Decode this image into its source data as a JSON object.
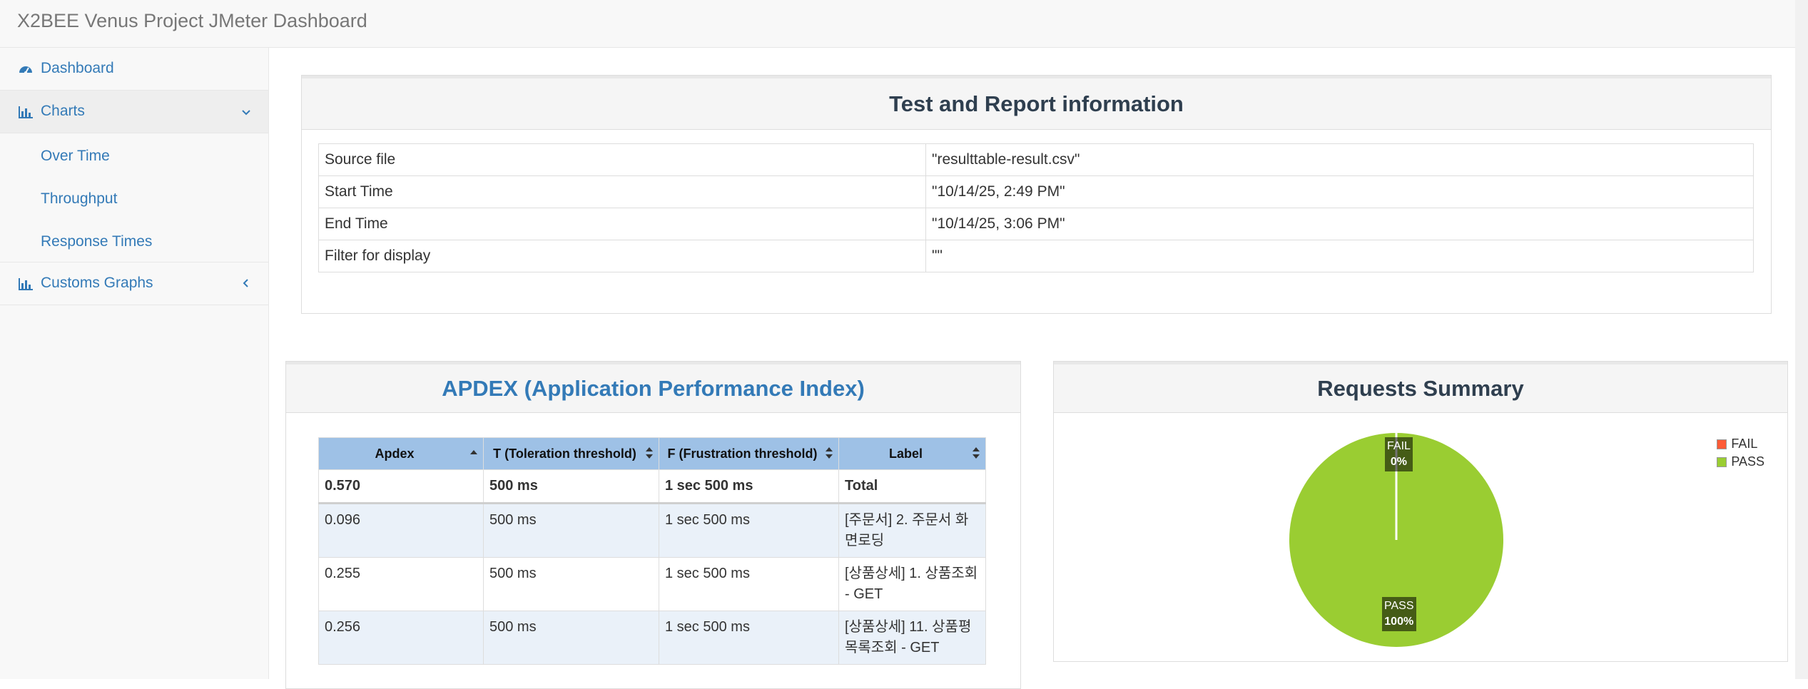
{
  "navbar": {
    "brand": "X2BEE Venus Project JMeter Dashboard"
  },
  "sidebar": {
    "items": [
      {
        "label": "Dashboard",
        "icon": "dashboard-icon"
      },
      {
        "label": "Charts",
        "icon": "bar-chart-icon",
        "expanded": true
      },
      {
        "label": "Customs Graphs",
        "icon": "bar-chart-icon",
        "expanded": false
      }
    ],
    "chart_subitems": [
      "Over Time",
      "Throughput",
      "Response Times"
    ]
  },
  "report_info": {
    "title": "Test and Report information",
    "rows": [
      {
        "key": "Source file",
        "value": "\"resulttable-result.csv\""
      },
      {
        "key": "Start Time",
        "value": "\"10/14/25, 2:49 PM\""
      },
      {
        "key": "End Time",
        "value": "\"10/14/25, 3:06 PM\""
      },
      {
        "key": "Filter for display",
        "value": "\"\""
      }
    ]
  },
  "apdex": {
    "title": "APDEX (Application Performance Index)",
    "columns": [
      "Apdex",
      "T (Toleration threshold)",
      "F (Frustration threshold)",
      "Label"
    ],
    "total": [
      "0.570",
      "500 ms",
      "1 sec 500 ms",
      "Total"
    ],
    "rows": [
      [
        "0.096",
        "500 ms",
        "1 sec 500 ms",
        "[주문서] 2. 주문서 화면로딩"
      ],
      [
        "0.255",
        "500 ms",
        "1 sec 500 ms",
        "[상품상세] 1. 상품조회 - GET"
      ],
      [
        "0.256",
        "500 ms",
        "1 sec 500 ms",
        "[상품상세] 11. 상품평목록조회 - GET"
      ]
    ]
  },
  "requests_summary": {
    "title": "Requests Summary",
    "legend": [
      {
        "label": "FAIL",
        "color": "#ff5b37"
      },
      {
        "label": "PASS",
        "color": "#9acd32"
      }
    ],
    "labels": {
      "fail_name": "FAIL",
      "fail_pct": "0%",
      "pass_name": "PASS",
      "pass_pct": "100%"
    }
  },
  "chart_data": {
    "type": "pie",
    "title": "Requests Summary",
    "categories": [
      "FAIL",
      "PASS"
    ],
    "values": [
      0,
      100
    ],
    "colors": [
      "#ff5b37",
      "#9acd32"
    ],
    "legend": "top-right"
  },
  "colors": {
    "link": "#337ab7",
    "header_bg": "#9ec1e6",
    "pass": "#9acd32",
    "fail": "#ff5b37"
  }
}
